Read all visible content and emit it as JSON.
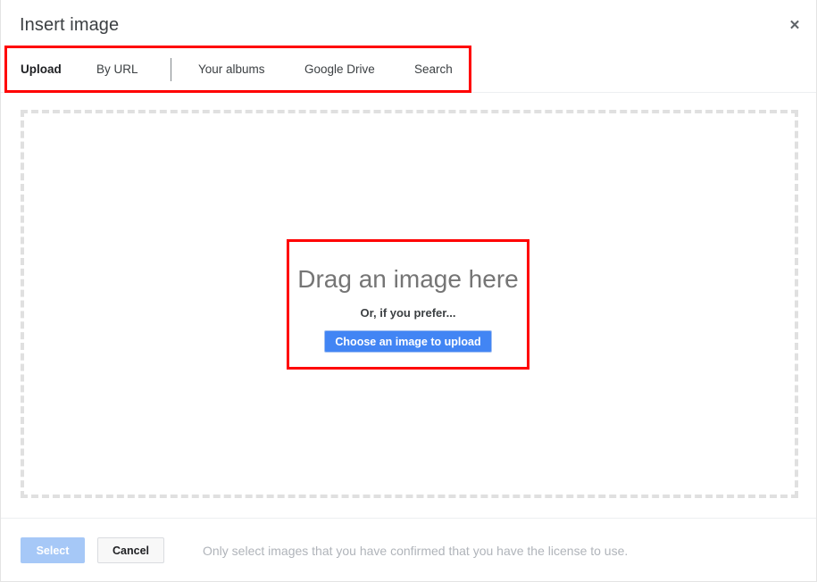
{
  "dialog": {
    "title": "Insert image",
    "close_icon_label": "close-icon",
    "close_glyph": "✕"
  },
  "tabs": {
    "items": [
      {
        "label": "Upload",
        "active": true
      },
      {
        "label": "By URL",
        "active": false
      },
      {
        "label": "Your albums",
        "active": false
      },
      {
        "label": "Google Drive",
        "active": false
      },
      {
        "label": "Search",
        "active": false
      }
    ],
    "highlight_color": "#ff0000"
  },
  "dropzone": {
    "drag_label": "Drag an image here",
    "or_label": "Or, if you prefer...",
    "choose_button_label": "Choose an image to upload",
    "choose_button_color": "#4285f4",
    "border_style": "dashed",
    "border_color": "#e0e0e0",
    "highlight_color": "#ff0000"
  },
  "footer": {
    "select_label": "Select",
    "select_disabled_color": "#a6c8f7",
    "cancel_label": "Cancel",
    "license_note": "Only select images that you have confirmed that you have the license to use."
  }
}
